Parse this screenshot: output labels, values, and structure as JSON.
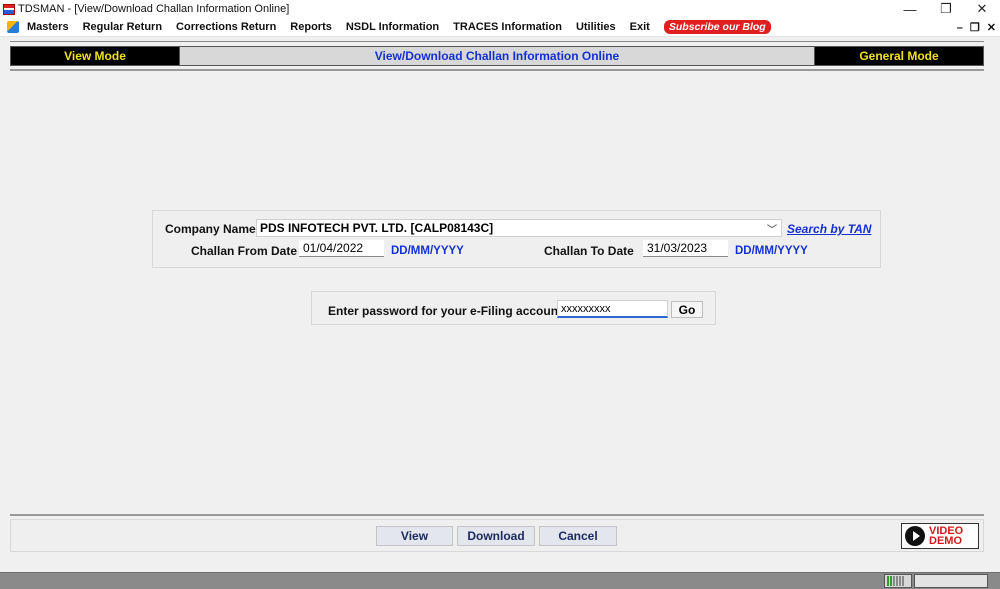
{
  "window": {
    "title": "TDSMAN - [View/Download Challan Information Online]",
    "controls": [
      "—",
      "❐",
      "✕"
    ]
  },
  "menu": {
    "items": [
      "Masters",
      "Regular Return",
      "Corrections Return",
      "Reports",
      "NSDL Information",
      "TRACES Information",
      "Utilities",
      "Exit"
    ],
    "subscribe_label": "Subscribe our Blog",
    "mdi_controls": [
      "–",
      "❐",
      "✕"
    ]
  },
  "header": {
    "left_mode": "View Mode",
    "title": "View/Download Challan Information Online",
    "right_mode": "General Mode"
  },
  "filters": {
    "company_label": "Company Name",
    "company_value": "PDS INFOTECH PVT. LTD. [CALP08143C]",
    "search_by_tan": "Search by TAN",
    "from_label": "Challan From Date",
    "from_value": "01/04/2022",
    "to_label": "Challan To Date",
    "to_value": "31/03/2023",
    "date_format": "DD/MM/YYYY"
  },
  "password": {
    "label": "Enter password for your e-Filing account",
    "value": "xxxxxxxxx",
    "go_label": "Go"
  },
  "actions": {
    "view": "View",
    "download": "Download",
    "cancel": "Cancel",
    "video_line1": "VIDEO",
    "video_line2": "DEMO"
  },
  "colors": {
    "accent_blue": "#1530d0",
    "mode_yellow": "#f0e020",
    "subscribe_red": "#e02020"
  }
}
